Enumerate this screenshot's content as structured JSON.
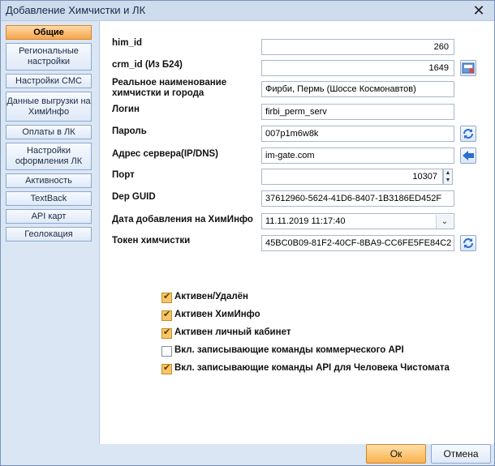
{
  "window": {
    "title": "Добавление Химчистки и ЛК",
    "close": "✕"
  },
  "sidebar": {
    "items": [
      {
        "label": "Общие"
      },
      {
        "label": "Региональные настройки"
      },
      {
        "label": "Настройки СМС"
      },
      {
        "label": "Данные выгрузки на ХимИнфо"
      },
      {
        "label": "Оплаты в ЛК"
      },
      {
        "label": "Настройки оформления ЛК"
      },
      {
        "label": "Активность"
      },
      {
        "label": "TextBack"
      },
      {
        "label": "API карт"
      },
      {
        "label": "Геолокация"
      }
    ]
  },
  "form": {
    "him_id": {
      "label": "him_id",
      "value": "260"
    },
    "crm_id": {
      "label": "crm_id (Из Б24)",
      "value": "1649"
    },
    "real_name": {
      "label": "Реальное наименование химчистки и города",
      "value": "Фирби, Пермь (Шоссе Космонавтов)"
    },
    "login": {
      "label": "Логин",
      "value": "firbi_perm_serv"
    },
    "password": {
      "label": "Пароль",
      "value": "007p1m6w8k"
    },
    "server": {
      "label": "Адрес сервера(IP/DNS)",
      "value": "im-gate.com"
    },
    "port": {
      "label": "Порт",
      "value": "10307"
    },
    "dep_guid": {
      "label": "Dep GUID",
      "value": "37612960-5624-41D6-8407-1B3186ED452F"
    },
    "date_added": {
      "label": "Дата добавления на ХимИнфо",
      "value": "11.11.2019 11:17:40"
    },
    "token": {
      "label": "Токен химчистки",
      "value": "45BC0B09-81F2-40CF-8BA9-CC6FE5FE84C2"
    }
  },
  "checkboxes": [
    {
      "label": "Активен/Удалён",
      "checked": true
    },
    {
      "label": "Активен ХимИнфо",
      "checked": true
    },
    {
      "label": "Активен личный кабинет",
      "checked": true
    },
    {
      "label": "Вкл. записывающие команды коммерческого API",
      "checked": false
    },
    {
      "label": "Вкл. записывающие команды API для Человека Чистомата",
      "checked": true
    }
  ],
  "footer": {
    "ok": "Ок",
    "cancel": "Отмена"
  }
}
